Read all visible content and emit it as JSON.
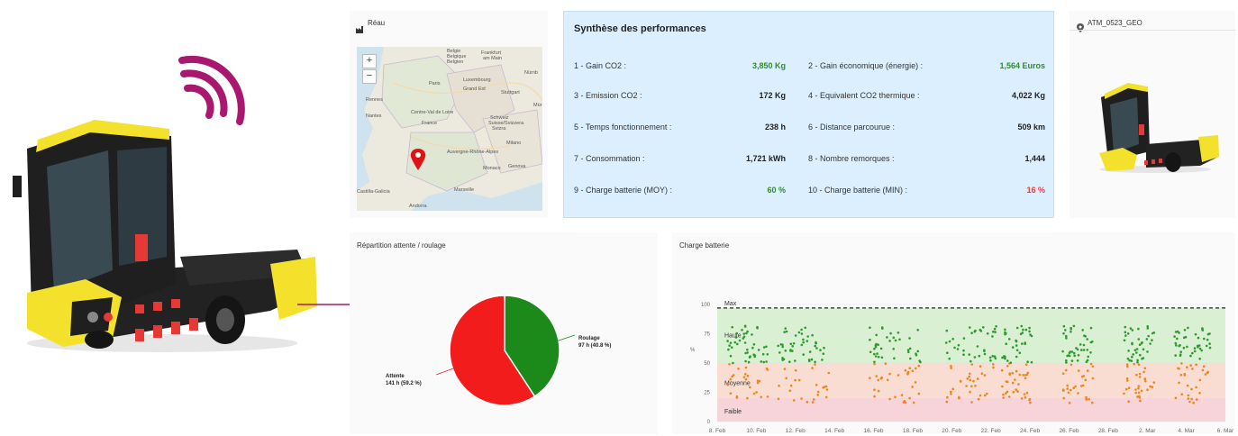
{
  "map": {
    "title": "Réau",
    "zoom_in": "+",
    "zoom_out": "−",
    "labels": [
      "Belgie",
      "Belgique",
      "Belgien",
      "Frankfurt",
      "am Main",
      "Nürnb",
      "Luxembourg",
      "Paris",
      "Grand Est",
      "Stuttgart",
      "Rennes",
      "Nantes",
      "Centre-Val de Loire",
      "France",
      "Schweiz",
      "Suisse/Svizzera",
      "Svizra",
      "Milano",
      "Auvergne-Rhône-Alpes",
      "Monaco",
      "Marseille",
      "Genova",
      "Castilla-Galicia",
      "Andorra",
      "Mür"
    ]
  },
  "perf": {
    "title": "Synthèse des performances",
    "rows": [
      {
        "label": "1 - Gain CO2 :",
        "value": "3,850 Kg",
        "color": "#2e8b2e"
      },
      {
        "label": "2 - Gain économique (énergie) :",
        "value": "1,564 Euros",
        "color": "#2e8b2e"
      },
      {
        "label": "3 - Emission CO2 :",
        "value": "172 Kg",
        "color": "#222222"
      },
      {
        "label": "4 - Equivalent CO2 thermique :",
        "value": "4,022 Kg",
        "color": "#222222"
      },
      {
        "label": "5 - Temps fonctionnement :",
        "value": "238 h",
        "color": "#222222"
      },
      {
        "label": "6 - Distance parcourue :",
        "value": "509 km",
        "color": "#222222"
      },
      {
        "label": "7 - Consommation :",
        "value": "1,721 kWh",
        "color": "#222222"
      },
      {
        "label": "8 - Nombre remorques :",
        "value": "1,444",
        "color": "#222222"
      },
      {
        "label": "9 - Charge batterie (MOY) :",
        "value": "60 %",
        "color": "#2e8b2e"
      },
      {
        "label": "10 - Charge batterie (MIN) :",
        "value": "16 %",
        "color": "#e53935"
      }
    ]
  },
  "asset": {
    "name": "ATM_0523_GEO"
  },
  "pie": {
    "title": "Répartition attente / roulage",
    "labels": [
      {
        "name": "Roulage",
        "detail": "97 h (40.8 %)"
      },
      {
        "name": "Attente",
        "detail": "141 h (59.2 %)"
      }
    ]
  },
  "battery": {
    "title": "Charge batterie",
    "y_unit": "%",
    "band_labels": [
      "Max",
      "Haute",
      "Moyenne",
      "Faible"
    ],
    "y_ticks": [
      "100",
      "75",
      "50",
      "25",
      "0"
    ],
    "x_ticks": [
      "8. Feb",
      "10. Feb",
      "12. Feb",
      "14. Feb",
      "16. Feb",
      "18. Feb",
      "20. Feb",
      "22. Feb",
      "24. Feb",
      "26. Feb",
      "28. Feb",
      "2. Mar",
      "4. Mar",
      "6. Mar"
    ]
  },
  "chart_data": [
    {
      "type": "pie",
      "title": "Répartition attente / roulage",
      "categories": [
        "Roulage",
        "Attente"
      ],
      "values": [
        97,
        141
      ],
      "percentages": [
        40.8,
        59.2
      ],
      "unit": "h",
      "colors": [
        "#1b8a1b",
        "#f21c1c"
      ]
    },
    {
      "type": "scatter",
      "title": "Charge batterie",
      "ylabel": "%",
      "ylim": [
        0,
        100
      ],
      "x_range": [
        "8. Feb",
        "6. Mar"
      ],
      "threshold_lines": [
        {
          "name": "Max",
          "value": 97
        }
      ],
      "bands": [
        {
          "name": "Haute",
          "range": [
            50,
            97
          ],
          "color": "#d9f0d3"
        },
        {
          "name": "Moyenne",
          "range": [
            20,
            50
          ],
          "color": "#f9ddd2"
        },
        {
          "name": "Faible",
          "range": [
            0,
            20
          ],
          "color": "#f7d4d9"
        }
      ],
      "series": [
        {
          "color": "#2e9a2e",
          "level_range": [
            50,
            82
          ]
        },
        {
          "color": "#f0851c",
          "level_range": [
            16,
            50
          ]
        }
      ]
    }
  ]
}
